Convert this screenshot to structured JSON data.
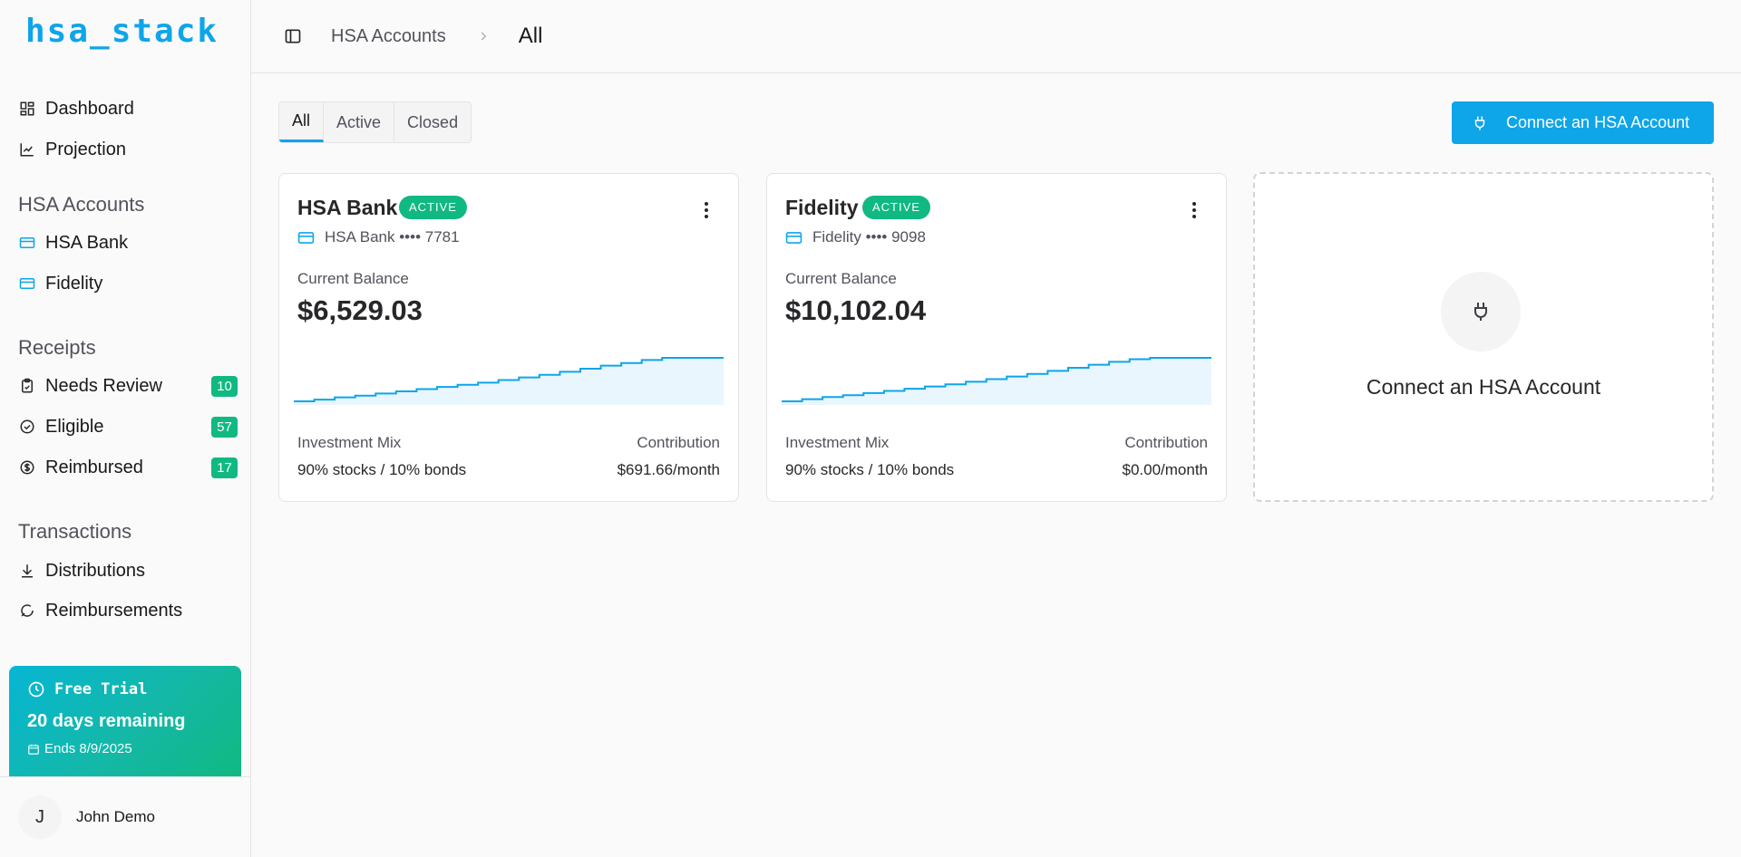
{
  "app": {
    "logo": "hsa_stack"
  },
  "sidebar": {
    "main_items": [
      {
        "label": "Dashboard",
        "icon": "dashboard-icon"
      },
      {
        "label": "Projection",
        "icon": "chart-line-icon"
      }
    ],
    "hsa_section": {
      "label": "HSA Accounts",
      "items": [
        {
          "label": "HSA Bank",
          "icon": "credit-card-icon"
        },
        {
          "label": "Fidelity",
          "icon": "credit-card-icon"
        }
      ]
    },
    "receipts_section": {
      "label": "Receipts",
      "items": [
        {
          "label": "Needs Review",
          "icon": "clipboard-check-icon",
          "count": "10"
        },
        {
          "label": "Eligible",
          "icon": "check-circle-icon",
          "count": "57"
        },
        {
          "label": "Reimbursed",
          "icon": "dollar-circle-icon",
          "count": "17"
        }
      ]
    },
    "transactions_section": {
      "label": "Transactions",
      "items": [
        {
          "label": "Distributions",
          "icon": "download-icon"
        },
        {
          "label": "Reimbursements",
          "icon": "refresh-icon"
        }
      ]
    },
    "trial": {
      "title": "Free Trial",
      "days": "20 days remaining",
      "ends": "Ends 8/9/2025"
    },
    "user": {
      "initial": "J",
      "name": "John Demo"
    }
  },
  "header": {
    "breadcrumb": "HSA Accounts",
    "current": "All"
  },
  "tabs": [
    {
      "label": "All",
      "active": true
    },
    {
      "label": "Active",
      "active": false
    },
    {
      "label": "Closed",
      "active": false
    }
  ],
  "connect_button": {
    "label": "Connect an HSA Account"
  },
  "accounts": [
    {
      "name": "HSA Bank",
      "status": "ACTIVE",
      "account_line": "HSA Bank •••• 7781",
      "balance_label": "Current Balance",
      "balance": "$6,529.03",
      "mix_label": "Investment Mix",
      "mix": "90% stocks / 10% bonds",
      "contribution_label": "Contribution",
      "contribution": "$691.66/month",
      "trend": [
        0,
        0.04,
        0.09,
        0.13,
        0.18,
        0.23,
        0.28,
        0.33,
        0.38,
        0.43,
        0.49,
        0.55,
        0.61,
        0.68,
        0.75,
        0.82,
        0.88,
        0.95,
        1,
        1,
        1,
        1
      ]
    },
    {
      "name": "Fidelity",
      "status": "ACTIVE",
      "account_line": "Fidelity •••• 9098",
      "balance_label": "Current Balance",
      "balance": "$10,102.04",
      "mix_label": "Investment Mix",
      "mix": "90% stocks / 10% bonds",
      "contribution_label": "Contribution",
      "contribution": "$0.00/month",
      "trend": [
        0,
        0.05,
        0.1,
        0.14,
        0.19,
        0.24,
        0.29,
        0.34,
        0.39,
        0.45,
        0.51,
        0.57,
        0.63,
        0.7,
        0.77,
        0.84,
        0.91,
        0.97,
        1,
        1,
        1,
        1
      ]
    }
  ],
  "connect_card": {
    "label": "Connect an HSA Account",
    "icon": "plug-icon"
  },
  "colors": {
    "accent": "#0ea5e9",
    "success": "#10b981"
  }
}
